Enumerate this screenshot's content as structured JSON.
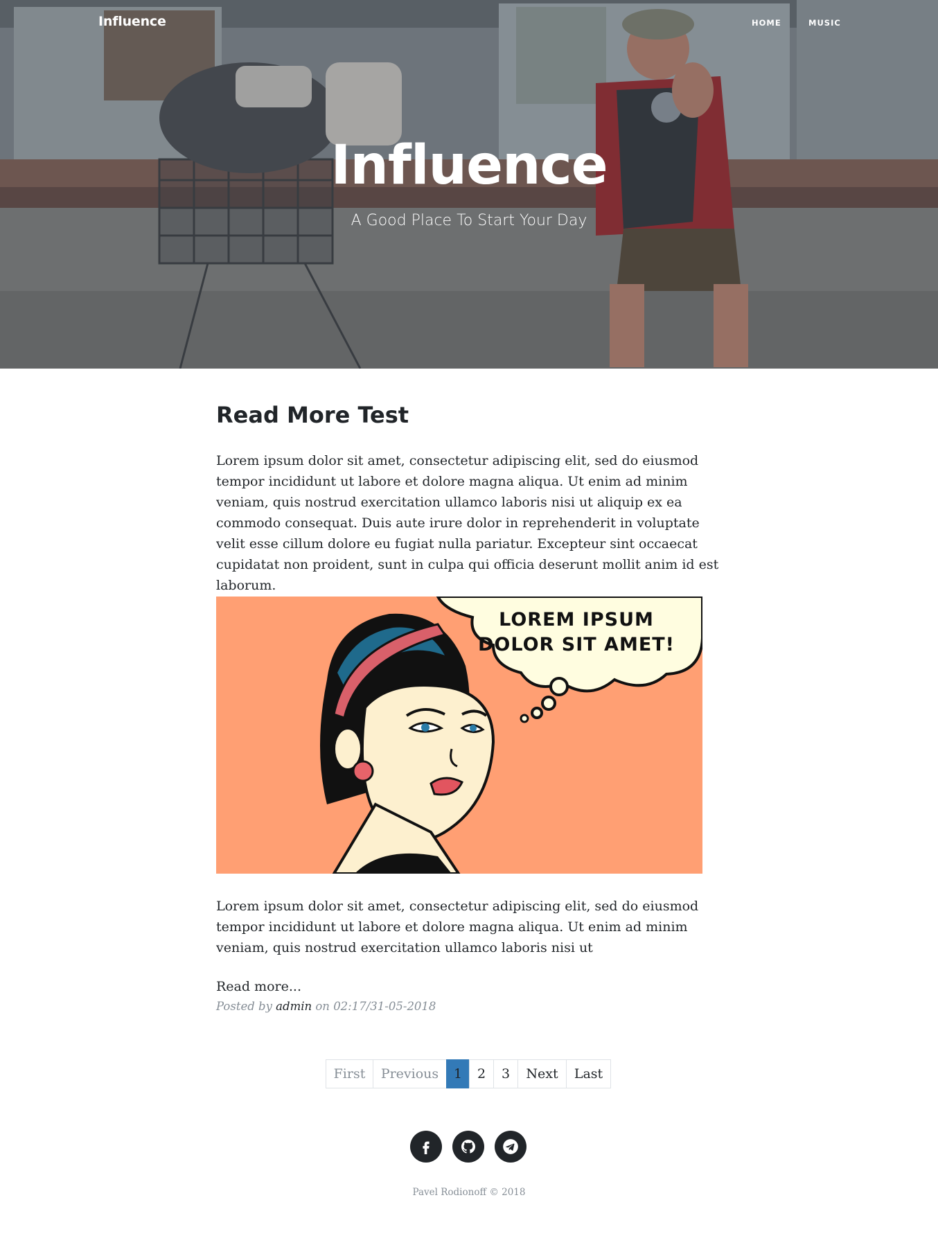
{
  "navbar": {
    "brand": "Influence",
    "links": [
      {
        "label": "HOME"
      },
      {
        "label": "MUSIC"
      }
    ]
  },
  "hero": {
    "title": "Influence",
    "subtitle": "A Good Place To Start Your Day",
    "background_image": "street photo: man posing beside a shopping cart"
  },
  "post": {
    "title": "Read More Test",
    "paragraph1": "Lorem ipsum dolor sit amet, consectetur adipiscing elit, sed do eiusmod tempor incididunt ut labore et dolore magna aliqua. Ut enim ad minim veniam, quis nostrud exercitation ullamco laboris nisi ut aliquip ex ea commodo consequat. Duis aute irure dolor in reprehenderit in voluptate velit esse cillum dolore eu fugiat nulla pariatur. Excepteur sint occaecat cupidatat non proident, sunt in culpa qui officia deserunt mollit anim id est laborum.",
    "image": {
      "bubble_line1": "LOREM IPSUM",
      "bubble_line2": "DOLOR SIT AMET!",
      "background_color": "#ff9f73"
    },
    "paragraph2": "Lorem ipsum dolor sit amet, consectetur adipiscing elit, sed do eiusmod tempor incididunt ut labore et dolore magna aliqua. Ut enim ad minim veniam, quis nostrud exercitation ullamco laboris nisi ut",
    "read_more": "Read more...",
    "meta": {
      "posted_by": "Posted by",
      "author": "admin",
      "on": "on",
      "datetime": "02:17/31-05-2018"
    }
  },
  "pagination": {
    "first": "First",
    "previous": "Previous",
    "pages": [
      "1",
      "2",
      "3"
    ],
    "current_page": "1",
    "next": "Next",
    "last": "Last",
    "active_color": "#337ab7"
  },
  "footer": {
    "social": [
      {
        "icon": "facebook-icon"
      },
      {
        "icon": "github-icon"
      },
      {
        "icon": "telegram-icon"
      }
    ],
    "copyright": "Pavel Rodionoff © 2018"
  }
}
